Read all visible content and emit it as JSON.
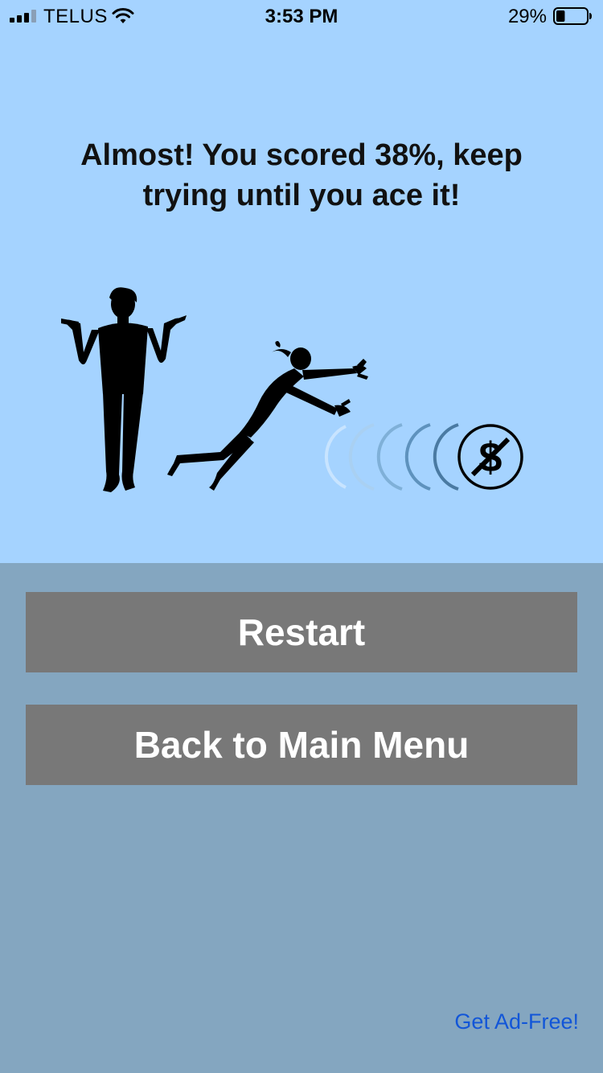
{
  "status_bar": {
    "carrier": "TELUS",
    "time": "3:53 PM",
    "battery_percent": "29%",
    "battery_level": 0.29,
    "signal_bars_active": 3,
    "signal_bars_total": 4
  },
  "result": {
    "message": "Almost! You scored 38%, keep trying until you ace it!",
    "score_percent": 38
  },
  "illustration": {
    "coin_symbol": "$",
    "icons": [
      "shrugging-man-icon",
      "diving-woman-icon",
      "motion-arcs-icon",
      "no-dollar-coin-icon"
    ]
  },
  "buttons": {
    "restart_label": "Restart",
    "main_menu_label": "Back to Main Menu"
  },
  "footer": {
    "ad_free_link": "Get Ad-Free!"
  },
  "colors": {
    "top_background": "#a5d3ff",
    "bottom_background": "#84a6c0",
    "button_background": "#787878",
    "button_text": "#ffffff",
    "link_color": "#1256d8"
  }
}
